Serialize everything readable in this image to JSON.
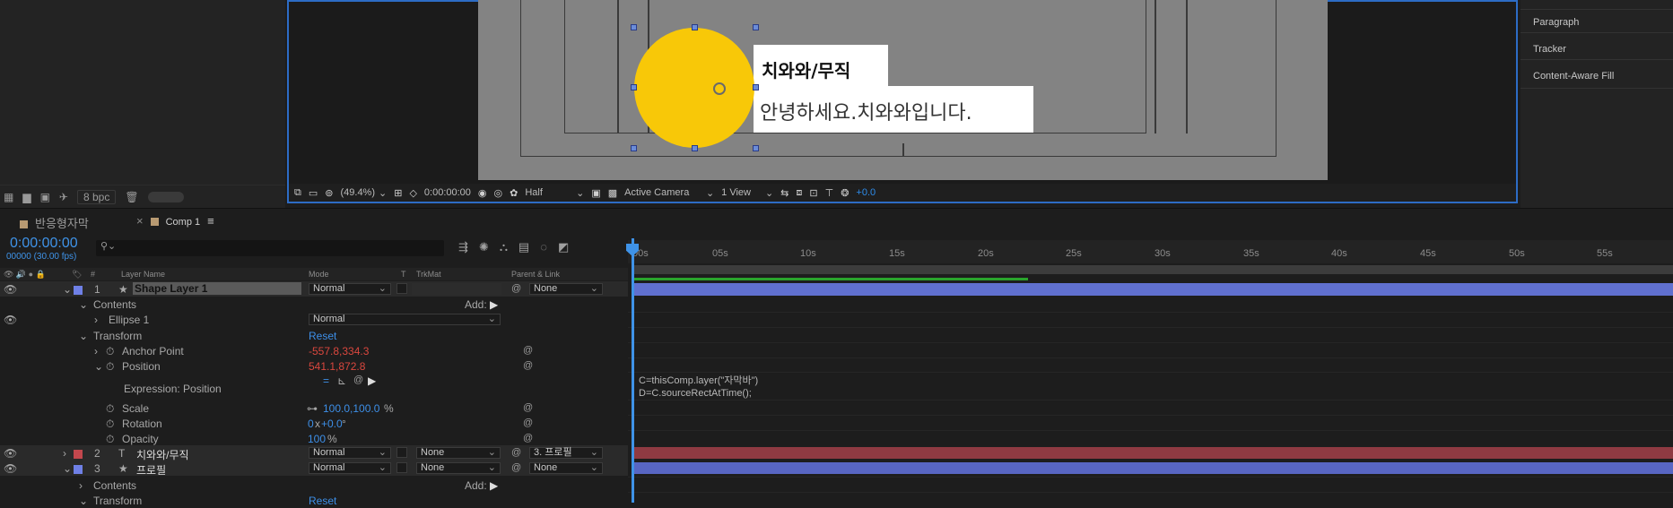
{
  "project_panel": {
    "bpc": "8 bpc"
  },
  "viewer": {
    "title_text": "치와와/무직",
    "greeting_text": "안녕하세요.치와와입니다.",
    "zoom": "(49.4%)",
    "timecode": "0:00:00:00",
    "resolution": "Half",
    "camera": "Active Camera",
    "views": "1 View",
    "exposure": "+0.0"
  },
  "right_panel": {
    "items": [
      "Paragraph",
      "Tracker",
      "Content-Aware Fill"
    ]
  },
  "tabs": [
    {
      "label": "반응형자막"
    },
    {
      "label": "Comp 1"
    }
  ],
  "timeline": {
    "current_time": "0:00:00:00",
    "fps": "00000 (30.00 fps)",
    "headers": {
      "num": "#",
      "layer_name": "Layer Name",
      "mode": "Mode",
      "t": "T",
      "trkmat": "TrkMat",
      "parent": "Parent & Link"
    },
    "ruler": [
      "00s",
      "05s",
      "10s",
      "15s",
      "20s",
      "25s",
      "30s",
      "35s",
      "40s",
      "45s",
      "50s",
      "55s"
    ],
    "layer1": {
      "num": "1",
      "name": "Shape Layer 1",
      "mode": "Normal",
      "parent": "None"
    },
    "contents": "Contents",
    "add": "Add:",
    "ellipse": "Ellipse 1",
    "ellipse_mode": "Normal",
    "transform": "Transform",
    "reset": "Reset",
    "anchor_point": {
      "label": "Anchor Point",
      "value": "-557.8,334.3"
    },
    "position": {
      "label": "Position",
      "value": "541.1,872.8"
    },
    "expression_label": "Expression: Position",
    "scale": {
      "label": "Scale",
      "value": "100.0,100.0",
      "unit": "%"
    },
    "rotation": {
      "label": "Rotation",
      "value_x": "0",
      "sep": "x",
      "value": "+0.0",
      "unit": "°"
    },
    "opacity": {
      "label": "Opacity",
      "value": "100",
      "unit": "%"
    },
    "layer2": {
      "num": "2",
      "name": "치와와/무직",
      "mode": "Normal",
      "trkmat": "None",
      "parent": "3. 프로필"
    },
    "layer3": {
      "num": "3",
      "name": "프로필",
      "mode": "Normal",
      "trkmat": "None",
      "parent": "None"
    },
    "contents2": "Contents",
    "add2": "Add:",
    "transform2": "Transform",
    "reset2": "Reset",
    "expression_line1": "C=thisComp.layer(\"자막바\")",
    "expression_line2": "D=C.sourceRectAtTime();"
  },
  "colors": {
    "accent": "#3f93e8",
    "layer1": "#6f80e6",
    "layer2": "#c2474d",
    "layer3": "#6f80e6",
    "circle": "#f8c808"
  }
}
